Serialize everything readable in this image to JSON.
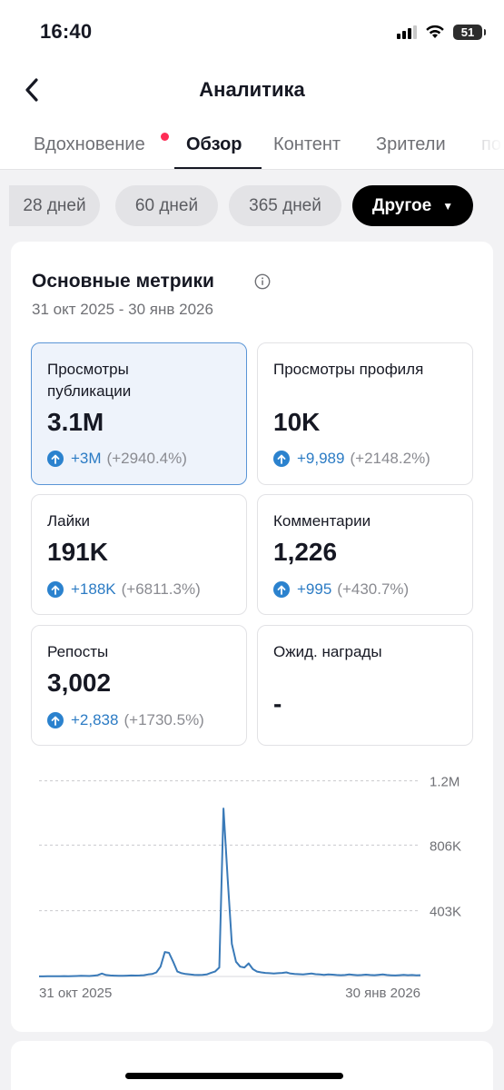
{
  "status": {
    "time": "16:40",
    "battery": "51"
  },
  "header": {
    "title": "Аналитика"
  },
  "tabs": [
    {
      "label": "Вдохновение",
      "has_dot": true
    },
    {
      "label": "Обзор",
      "active": true
    },
    {
      "label": "Контент"
    },
    {
      "label": "Зрители"
    },
    {
      "label": "по"
    }
  ],
  "ranges": [
    {
      "label": "28 дней"
    },
    {
      "label": "60 дней"
    },
    {
      "label": "365 дней"
    },
    {
      "label": "Другое",
      "active": true
    }
  ],
  "metrics_card": {
    "title": "Основные метрики",
    "date_range": "31 окт 2025 - 30 янв 2026",
    "items": [
      {
        "label": "Просмотры публикации",
        "value": "3.1M",
        "delta": "+3M",
        "pct": "(+2940.4%)",
        "selected": true
      },
      {
        "label": "Просмотры профиля",
        "value": "10K",
        "delta": "+9,989",
        "pct": "(+2148.2%)"
      },
      {
        "label": "Лайки",
        "value": "191K",
        "delta": "+188K",
        "pct": "(+6811.3%)"
      },
      {
        "label": "Комментарии",
        "value": "1,226",
        "delta": "+995",
        "pct": "(+430.7%)"
      },
      {
        "label": "Репосты",
        "value": "3,002",
        "delta": "+2,838",
        "pct": "(+1730.5%)"
      },
      {
        "label": "Ожид. награды",
        "value": "-"
      }
    ]
  },
  "colors": {
    "accent_blue": "#2b82ce",
    "line": "#3a7ab8",
    "selected_bg": "#eef3fb",
    "notification_dot": "#fe2c55"
  },
  "chart_data": {
    "type": "line",
    "y_ticks": [
      "1.2M",
      "806K",
      "403K"
    ],
    "y_tick_values": [
      1200000,
      806000,
      403000
    ],
    "x_labels": [
      "31 окт 2025",
      "30 янв 2026"
    ],
    "ylim": [
      0,
      1209000
    ],
    "grid": true,
    "series": [
      {
        "values": [
          500,
          800,
          1000,
          1200,
          900,
          1500,
          2000,
          1800,
          2500,
          3000,
          4000,
          3500,
          3000,
          5000,
          8000,
          18000,
          9000,
          6000,
          5000,
          4000,
          4000,
          5000,
          6000,
          5500,
          6000,
          8000,
          12000,
          15000,
          25000,
          60000,
          150000,
          145000,
          90000,
          30000,
          20000,
          15000,
          12000,
          10000,
          9000,
          10000,
          12000,
          22000,
          30000,
          55000,
          1030000,
          600000,
          200000,
          90000,
          60000,
          55000,
          80000,
          45000,
          30000,
          25000,
          22000,
          20000,
          18000,
          20000,
          22000,
          25000,
          18000,
          15000,
          14000,
          12000,
          15000,
          18000,
          14000,
          12000,
          10000,
          13000,
          11000,
          9000,
          8000,
          9000,
          12000,
          10000,
          8000,
          9000,
          11000,
          9000,
          8000,
          10000,
          12000,
          9000,
          7000,
          6000,
          8000,
          10000,
          8000,
          9000,
          7000,
          8000
        ]
      }
    ]
  }
}
